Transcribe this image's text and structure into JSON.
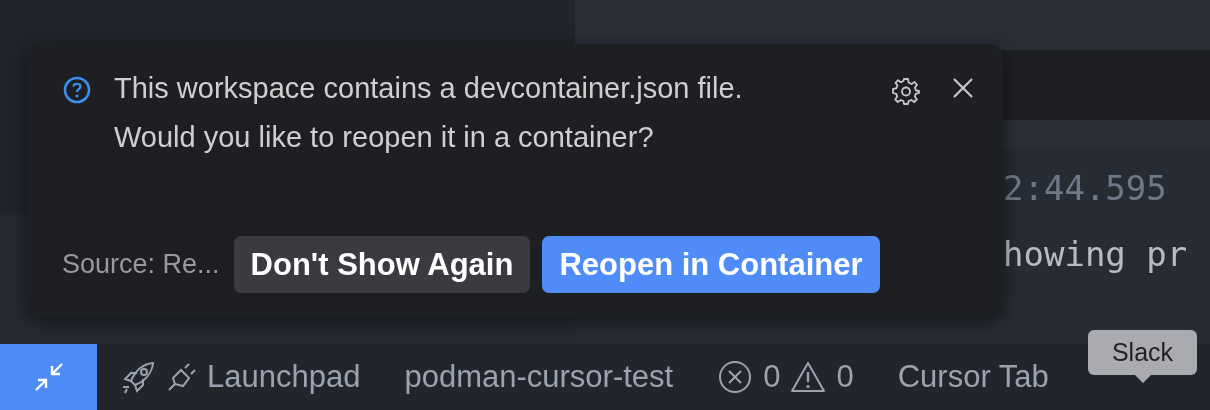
{
  "notification": {
    "message": "This workspace contains a devcontainer.json file. Would you like to reopen it in a container?",
    "source": "Source: Re...",
    "buttons": [
      {
        "label": "Don't Show Again",
        "kind": "secondary"
      },
      {
        "label": "Reopen in Container",
        "kind": "primary"
      }
    ]
  },
  "editor": {
    "lines": [
      "2:44.595",
      "howing pr"
    ]
  },
  "status_bar": {
    "items": [
      {
        "kind": "launchpad",
        "label": "Launchpad"
      },
      {
        "kind": "text",
        "label": "podman-cursor-test"
      },
      {
        "kind": "problems",
        "errors": "0",
        "warnings": "0"
      },
      {
        "kind": "text",
        "label": "Cursor Tab"
      }
    ]
  },
  "tooltip": {
    "text": "Slack"
  }
}
